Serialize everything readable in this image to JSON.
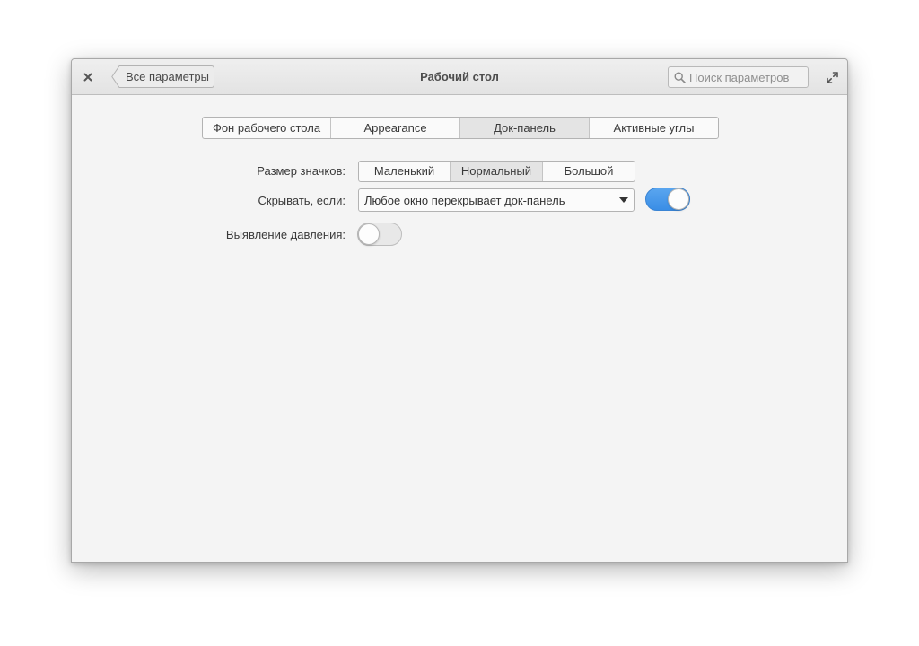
{
  "window": {
    "title": "Рабочий стол"
  },
  "header": {
    "back_label": "Все параметры",
    "search_placeholder": "Поиск параметров",
    "close_icon": "close-icon",
    "maximize_icon": "maximize-icon",
    "search_icon": "search-icon"
  },
  "tabs": [
    {
      "label": "Фон рабочего стола",
      "active": false
    },
    {
      "label": "Appearance",
      "active": false
    },
    {
      "label": "Док-панель",
      "active": true
    },
    {
      "label": "Активные углы",
      "active": false
    }
  ],
  "dock": {
    "icon_size": {
      "label": "Размер значков:",
      "options": [
        {
          "label": "Маленький",
          "active": false
        },
        {
          "label": "Нормальный",
          "active": true
        },
        {
          "label": "Большой",
          "active": false
        }
      ]
    },
    "hide": {
      "label": "Скрывать, если:",
      "selected": "Любое окно перекрывает док-панель",
      "enabled": true
    },
    "pressure": {
      "label": "Выявление давления:",
      "enabled": false
    }
  },
  "colors": {
    "accent": "#3a8ee6",
    "window_bg": "#f4f4f4",
    "header_bg": "#e8e8e8"
  }
}
